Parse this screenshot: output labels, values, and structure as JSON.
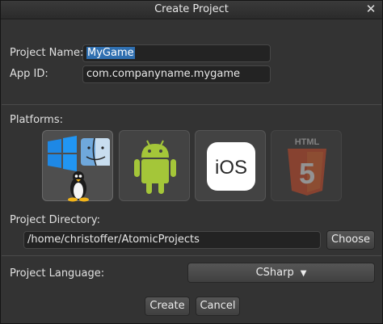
{
  "window": {
    "title": "Create Project",
    "close_glyph": "✕"
  },
  "form": {
    "project_name_label": "Project Name:",
    "project_name_value": "MyGame",
    "app_id_label": "App ID:",
    "app_id_value": "com.companyname.mygame",
    "platforms_label": "Platforms:",
    "platforms": [
      {
        "name": "Desktop (Windows, Mac, Linux)",
        "icons": [
          "windows-icon",
          "mac-finder-icon",
          "linux-tux-icon"
        ],
        "state": "selected"
      },
      {
        "name": "Android",
        "icons": [
          "android-icon"
        ],
        "state": "normal"
      },
      {
        "name": "iOS",
        "icon_text": "iOS",
        "icons": [
          "ios-icon"
        ],
        "state": "normal"
      },
      {
        "name": "HTML5",
        "icon_text": "HTML",
        "badge_text": "5",
        "icons": [
          "html5-icon"
        ],
        "state": "disabled"
      }
    ],
    "project_directory_label": "Project Directory:",
    "project_directory_value": "/home/christoffer/AtomicProjects",
    "choose_label": "Choose",
    "project_language_label": "Project Language:",
    "project_language_value": "CSharp"
  },
  "actions": {
    "create_label": "Create",
    "cancel_label": "Cancel"
  },
  "colors": {
    "window_bg": "#333333",
    "selection": "#2f6fb0",
    "android_green": "#a4c639",
    "html5_orange": "#e44d26"
  }
}
